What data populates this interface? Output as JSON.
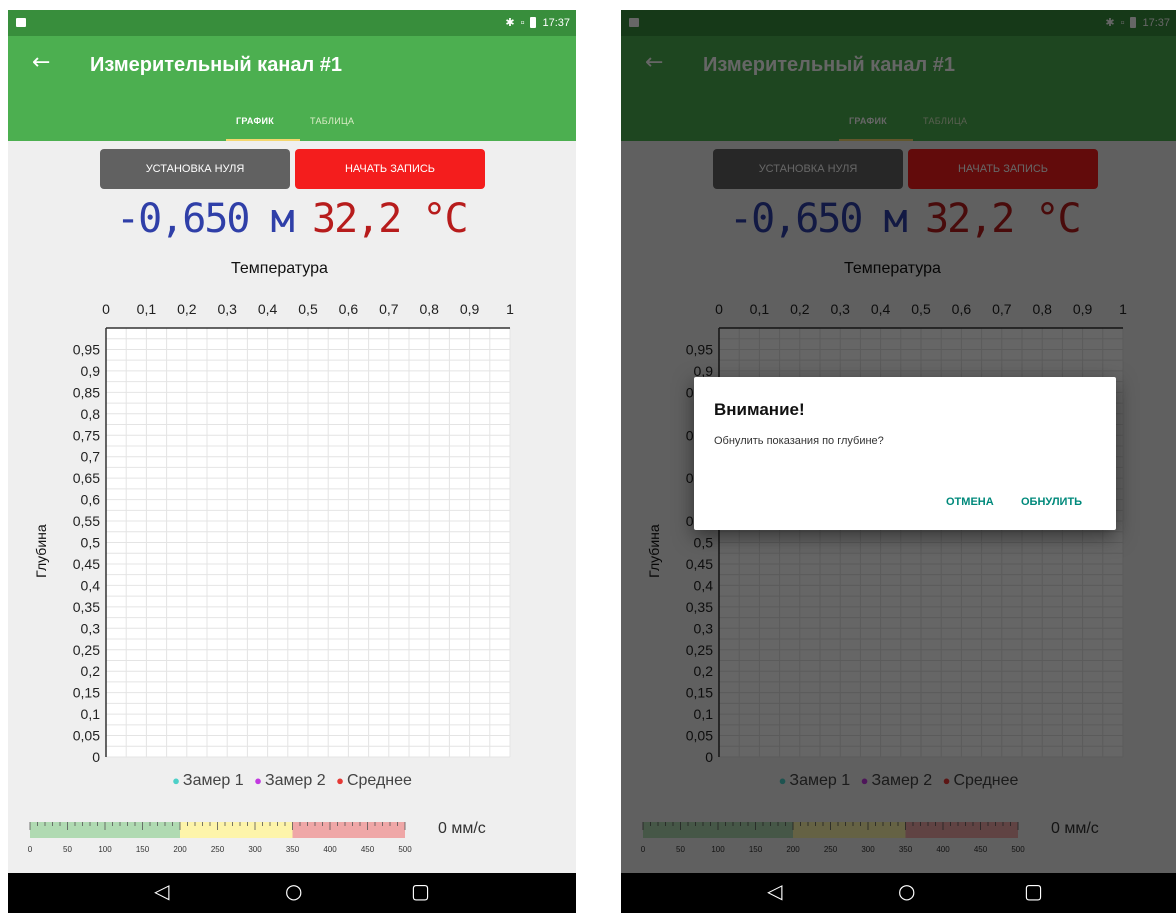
{
  "status_bar": {
    "time": "17:37",
    "icons": [
      "bluetooth-icon",
      "no-sim-icon",
      "battery-icon"
    ]
  },
  "toolbar": {
    "title": "Измерительный канал #1",
    "back_icon": "arrow-back-icon"
  },
  "tabs": [
    {
      "label": "ГРАФИК",
      "active": true
    },
    {
      "label": "ТАБЛИЦА",
      "active": false
    }
  ],
  "buttons": {
    "zero": "УСТАНОВКА НУЛЯ",
    "record": "НАЧАТЬ ЗАПИСЬ"
  },
  "readings": {
    "depth": "-0,650 м",
    "temperature": "32,2 °C"
  },
  "chart_data": {
    "type": "scatter",
    "xlabel": "Температура",
    "ylabel": "Глубина",
    "xlim": [
      0,
      1
    ],
    "ylim": [
      0,
      1
    ],
    "x_axis_position": "top",
    "y_reversed": true,
    "x_ticks": [
      "0",
      "0,1",
      "0,2",
      "0,3",
      "0,4",
      "0,5",
      "0,6",
      "0,7",
      "0,8",
      "0,9",
      "1"
    ],
    "y_ticks": [
      "0,95",
      "0,9",
      "0,85",
      "0,8",
      "0,75",
      "0,7",
      "0,65",
      "0,6",
      "0,55",
      "0,5",
      "0,45",
      "0,4",
      "0,35",
      "0,3",
      "0,25",
      "0,2",
      "0,15",
      "0,1",
      "0,05",
      "0"
    ],
    "grid": true,
    "legend_position": "bottom",
    "series": [
      {
        "name": "Замер 1",
        "color": "#4dd0c8",
        "values": []
      },
      {
        "name": "Замер 2",
        "color": "#c239e0",
        "values": []
      },
      {
        "name": "Среднее",
        "color": "#e53935",
        "values": []
      }
    ]
  },
  "speed_gauge": {
    "ticks": [
      "0",
      "50",
      "100",
      "150",
      "200",
      "250",
      "300",
      "350",
      "400",
      "450",
      "500"
    ],
    "zones": [
      {
        "from": 0,
        "to": 200,
        "color": "#a5d6a7"
      },
      {
        "from": 200,
        "to": 350,
        "color": "#fff59d"
      },
      {
        "from": 350,
        "to": 500,
        "color": "#ef9a9a"
      }
    ],
    "value_label": "0 мм/с"
  },
  "dialog": {
    "title": "Внимание!",
    "message": "Обнулить показания по глубине?",
    "cancel": "ОТМЕНА",
    "confirm": "ОБНУЛИТЬ"
  },
  "colors": {
    "primary": "#4caf50",
    "primary_dark": "#388e3c",
    "record": "#f41d1d",
    "depth_text": "#2f3fa8",
    "temp_text": "#b71c1c",
    "dialog_button": "#00897b"
  },
  "nav_icons": [
    "back-triangle-icon",
    "home-circle-icon",
    "recents-square-icon"
  ]
}
